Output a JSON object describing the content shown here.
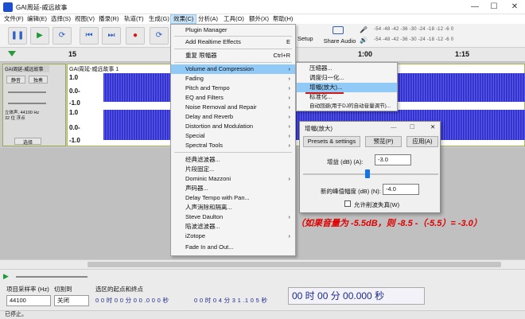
{
  "window": {
    "title": "GAI周延-威远故事",
    "minimize": "—",
    "maximize": "☐",
    "close": "✕"
  },
  "menubar": {
    "items": [
      "文件(F)",
      "编辑(E)",
      "选择(S)",
      "视图(V)",
      "播录(R)",
      "轨道(T)",
      "生成(G)",
      "效果(C)",
      "分析(A)",
      "工具(O)",
      "额外(X)",
      "帮助(H)"
    ]
  },
  "toolbar": {
    "pause": "❚❚",
    "play": "▶",
    "loop": "⟳",
    "skip_start": "⏮",
    "skip_end": "⏭",
    "record": "●",
    "setup": "Setup",
    "share_audio": "Share Audio",
    "meter_record": "-54  -48  -42  -36  -30  -24  -18  -12  -6  0",
    "meter_play": "-54  -48  -42  -36  -30  -24  -18  -12  -6  0",
    "meter_icon_rec": "mic-icon",
    "meter_icon_play": "speaker-icon"
  },
  "ruler": {
    "ticks": [
      "15",
      "30",
      "1:00",
      "1:15"
    ]
  },
  "track": {
    "name": "GAI周延-威远故事",
    "mute": "静音",
    "solo": "独奏",
    "info": "立体声, 44100 Hz\n32 位 浮点",
    "select": "选择",
    "clip_name": "GAI周延-威远故事 1",
    "scale_top": "1.0",
    "scale_mid": "0.0-",
    "scale_bot": "-1.0",
    "scale_top2": "1.0",
    "scale_mid2": "0.0-",
    "scale_bot2": "-1.0"
  },
  "effect_menu": {
    "items": [
      {
        "label": "Plugin Manager",
        "shortcut": ""
      },
      {
        "label": "Add Realtime Effects",
        "shortcut": "E"
      },
      {
        "label": "重复 限幅器",
        "shortcut": "Ctrl+R"
      },
      {
        "label": "Volume and Compression",
        "shortcut": "›"
      },
      {
        "label": "Fading",
        "shortcut": "›"
      },
      {
        "label": "Pitch and Tempo",
        "shortcut": "›"
      },
      {
        "label": "EQ and Filters",
        "shortcut": "›"
      },
      {
        "label": "Noise Removal and Repair",
        "shortcut": "›"
      },
      {
        "label": "Delay and Reverb",
        "shortcut": "›"
      },
      {
        "label": "Distortion and Modulation",
        "shortcut": "›"
      },
      {
        "label": "Special",
        "shortcut": "›"
      },
      {
        "label": "Spectral Tools",
        "shortcut": "›"
      },
      {
        "label": "经典滤波器...",
        "shortcut": ""
      },
      {
        "label": "片段固定...",
        "shortcut": ""
      },
      {
        "label": "Dominic Mazzoni",
        "shortcut": "›"
      },
      {
        "label": "声码器...",
        "shortcut": ""
      },
      {
        "label": "Delay Tempo with Pan...",
        "shortcut": ""
      },
      {
        "label": "人声消除和隔离...",
        "shortcut": ""
      },
      {
        "label": "Steve Daulton",
        "shortcut": "›"
      },
      {
        "label": "陷波滤波器...",
        "shortcut": ""
      },
      {
        "label": "iZotope",
        "shortcut": "›"
      },
      {
        "label": "Fade In and Out...",
        "shortcut": ""
      }
    ]
  },
  "volume_submenu": {
    "items": [
      "压缩器...",
      "调度归一化...",
      "增幅(放大)...",
      "标准化...",
      "自动回避(用于DJ的自动音量调节)..."
    ]
  },
  "amplify_dialog": {
    "title": "增幅(放大)",
    "presets": "Presets & settings",
    "preview": "预览(P)",
    "apply": "应用(A)",
    "gain_label": "增益 (dB) (A):",
    "gain_value": "-3.0",
    "peak_label": "新的峰值幅度 (dB) (N):",
    "peak_value": "-4.0",
    "allow_clip": "允许削波失真(W)",
    "min_icon": "—",
    "max_icon": "☐",
    "close_icon": "✕"
  },
  "annotation": "（如果音量为 -5.5dB，则 -8.5 -（-5.5）= -3.0）",
  "bottom": {
    "rate_label": "项目采样率 (Hz)",
    "snap_label": "切割到",
    "rate_value": "44100",
    "snap_value": "关闭",
    "selection_label": "选区的起点和终点",
    "sel_start": "0 0 时 0 0 分 0 0 .0 0 0 秒",
    "sel_end": "0 0 时 0 4 分 3 1 .1 0 5 秒",
    "big_time": "00 时 00 分 00.000 秒"
  },
  "status": "已停止。"
}
